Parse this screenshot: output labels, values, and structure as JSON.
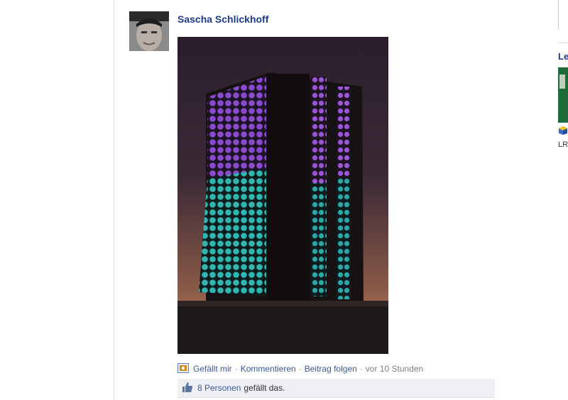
{
  "post": {
    "author_name": "Sascha Schlickhoff",
    "photo_description": "Night photo of a high-rise building with windows lit purple at top and cyan below, tilt-shift style"
  },
  "actions": {
    "like_label": "Gefällt mir",
    "comment_label": "Kommentieren",
    "follow_label": "Beitrag folgen",
    "timestamp": "vor 10 Stunden",
    "separator": "·"
  },
  "likes": {
    "count_link": "8 Personen",
    "suffix": "gefällt das."
  },
  "right_column": {
    "title_fragment": "Le",
    "text_fragment": "LR"
  },
  "colors": {
    "link": "#3b5998",
    "author": "#1b3a8a",
    "likes_bg": "#edeff4"
  }
}
